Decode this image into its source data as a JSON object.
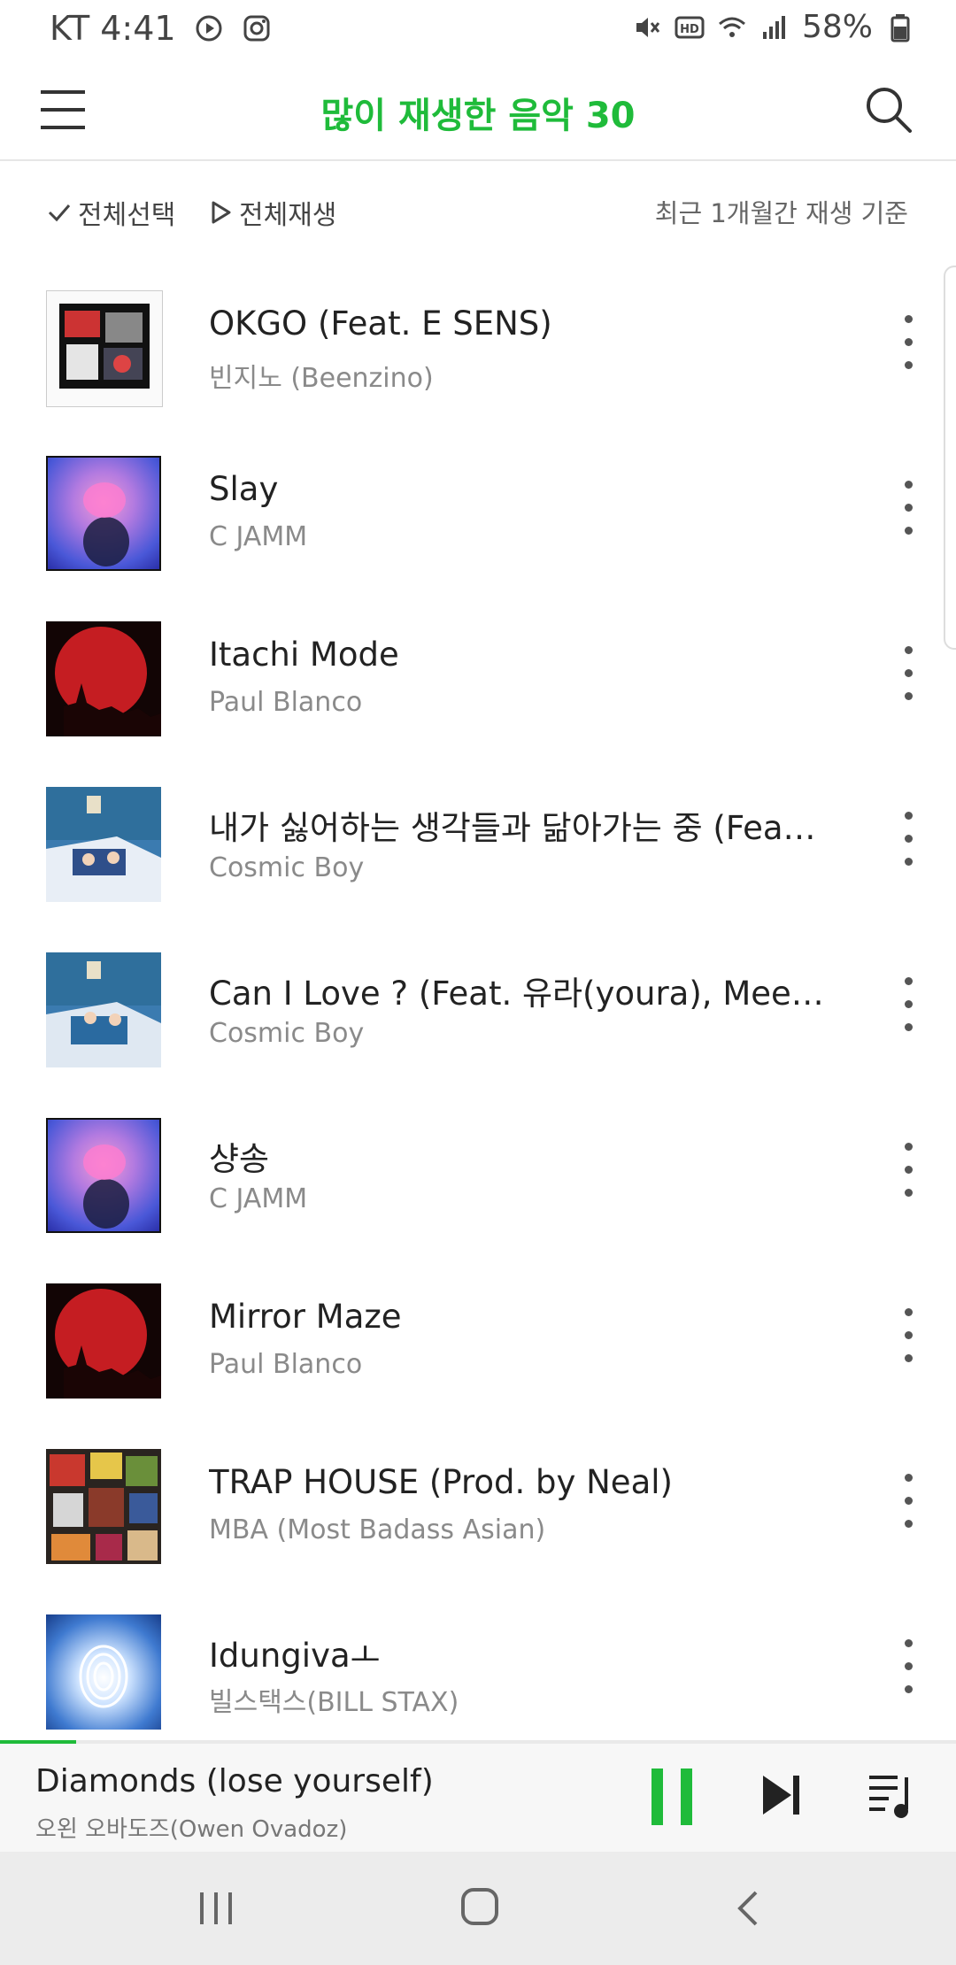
{
  "status_bar": {
    "carrier_time": "KT 4:41",
    "battery": "58%"
  },
  "header": {
    "title": "많이 재생한 음악 30"
  },
  "subbar": {
    "select_all": "전체선택",
    "play_all": "전체재생",
    "basis": "최근 1개월간 재생 기준"
  },
  "songs": [
    {
      "title": "OKGO (Feat. E SENS)",
      "artist": "빈지노 (Beenzino)"
    },
    {
      "title": "Slay",
      "artist": "C JAMM"
    },
    {
      "title": "Itachi Mode",
      "artist": "Paul Blanco"
    },
    {
      "title": "내가 싫어하는 생각들과 닮아가는 중 (Feat.…",
      "artist": "Cosmic Boy"
    },
    {
      "title": "Can I Love ? (Feat. 유라(youra), Meego)",
      "artist": "Cosmic Boy"
    },
    {
      "title": "샹송",
      "artist": "C JAMM"
    },
    {
      "title": "Mirror Maze",
      "artist": "Paul Blanco"
    },
    {
      "title": "TRAP HOUSE (Prod. by Neal)",
      "artist": "MBA (Most Badass Asian)"
    },
    {
      "title": "Idungivaㅗ",
      "artist": "빌스택스(BILL STAX)"
    }
  ],
  "player": {
    "title": "Diamonds (lose yourself)",
    "artist": "오왼 오바도즈(Owen Ovadoz)",
    "progress": 0.08
  },
  "colors": {
    "accent": "#1fbb3a"
  },
  "icons": [
    "menu-icon",
    "search-icon",
    "check-icon",
    "play-icon",
    "more-vertical-icon",
    "pause-icon",
    "skip-next-icon",
    "queue-icon",
    "recent-apps-icon",
    "home-icon",
    "back-icon"
  ]
}
